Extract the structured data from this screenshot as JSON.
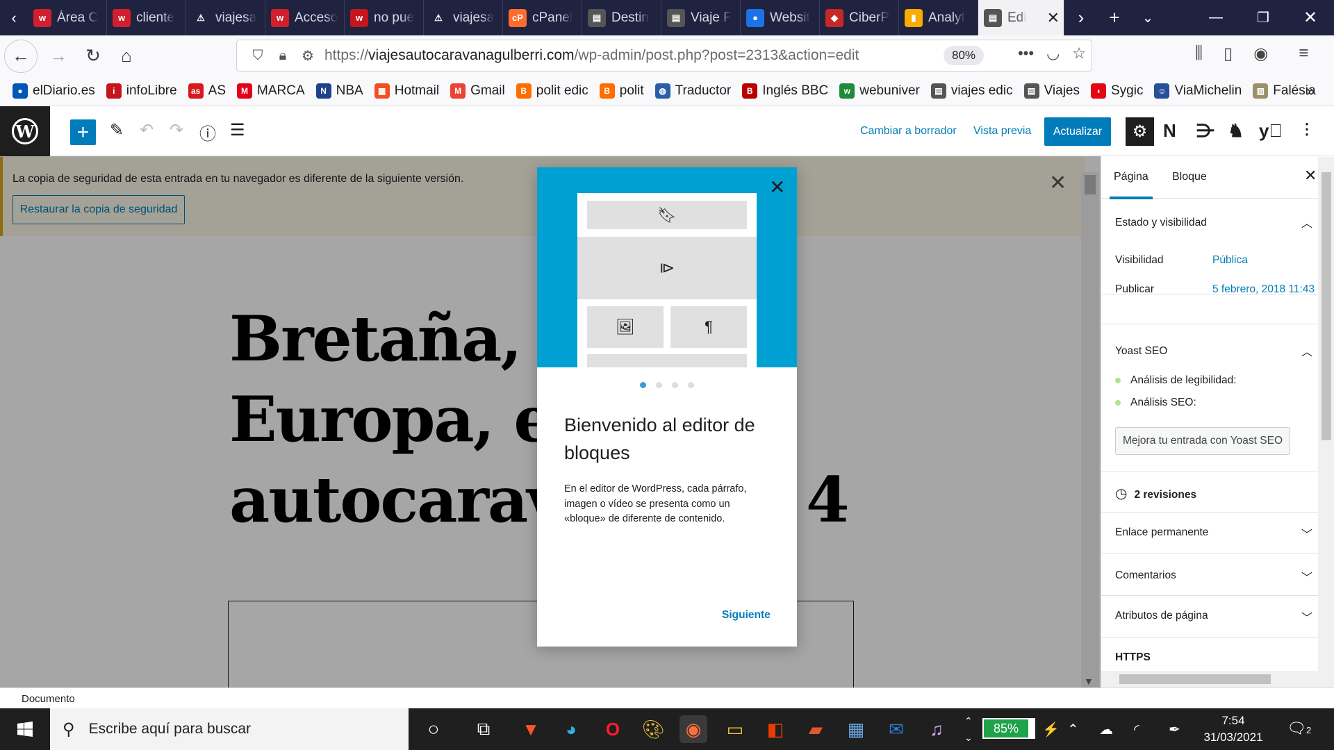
{
  "browser": {
    "tabs": [
      {
        "label": "Área C",
        "fav": "w",
        "color": "#d11f2d"
      },
      {
        "label": "cliente",
        "fav": "w",
        "color": "#d11f2d"
      },
      {
        "label": "viajesa",
        "fav": "⚠",
        "color": "#202340"
      },
      {
        "label": "Acceso",
        "fav": "w",
        "color": "#d11f2d"
      },
      {
        "label": "no pue",
        "fav": "w",
        "color": "#c4161c"
      },
      {
        "label": "viajesa",
        "fav": "⚠",
        "color": "#202340"
      },
      {
        "label": "cPanel",
        "fav": "cP",
        "color": "#ff6c2c"
      },
      {
        "label": "Destin",
        "fav": "▤",
        "color": "#555"
      },
      {
        "label": "Viaje F",
        "fav": "▤",
        "color": "#555"
      },
      {
        "label": "Websit",
        "fav": "●",
        "color": "#1a73e8"
      },
      {
        "label": "CiberP",
        "fav": "◆",
        "color": "#c62828"
      },
      {
        "label": "Analyt",
        "fav": "▮",
        "color": "#f9ab00"
      }
    ],
    "active_tab": {
      "label": "Edi"
    },
    "url_prefix": "https://",
    "url_domain": "viajesautocaravanagulberri.com",
    "url_path": "/wp-admin/post.php?post=2313&action=edit",
    "zoom": "80%",
    "bookmarks": [
      {
        "label": "elDiario.es",
        "fav": "●",
        "color": "#0057b8"
      },
      {
        "label": "infoLibre",
        "fav": "i",
        "color": "#c4161c"
      },
      {
        "label": "AS",
        "fav": "as",
        "color": "#d71920"
      },
      {
        "label": "MARCA",
        "fav": "M",
        "color": "#e2001a"
      },
      {
        "label": "NBA",
        "fav": "N",
        "color": "#1d428a"
      },
      {
        "label": "Hotmail",
        "fav": "▦",
        "color": "#f25022"
      },
      {
        "label": "Gmail",
        "fav": "M",
        "color": "#ea4335"
      },
      {
        "label": "polit edic",
        "fav": "B",
        "color": "#ff6d00"
      },
      {
        "label": "polit",
        "fav": "B",
        "color": "#ff6d00"
      },
      {
        "label": "Traductor",
        "fav": "◍",
        "color": "#2a5ea7"
      },
      {
        "label": "Inglés BBC",
        "fav": "B",
        "color": "#b80000"
      },
      {
        "label": "webuniver",
        "fav": "w",
        "color": "#1e8a3c"
      },
      {
        "label": "viajes edic",
        "fav": "▤",
        "color": "#555"
      },
      {
        "label": "Viajes",
        "fav": "▤",
        "color": "#555"
      },
      {
        "label": "Sygic",
        "fav": "◖",
        "color": "#e30613"
      },
      {
        "label": "ViaMichelin",
        "fav": "☺",
        "color": "#27509b"
      },
      {
        "label": "Falésia",
        "fav": "▥",
        "color": "#9c8f6a"
      }
    ]
  },
  "editor": {
    "header": {
      "switch_draft": "Cambiar a borrador",
      "preview": "Vista previa",
      "update": "Actualizar"
    },
    "notice": {
      "text": "La copia de seguridad de esta entrada en tu navegador es diferente de la siguiente versión.",
      "button": "Restaurar la copia de seguridad"
    },
    "post_title_lines": [
      "Bretaña, Fr",
      "Europa, en",
      "autocarava"
    ],
    "title_tail": "4",
    "footer": "Documento"
  },
  "sidebar": {
    "tabs": [
      "Página",
      "Bloque"
    ],
    "status_title": "Estado y visibilidad",
    "visibility_label": "Visibilidad",
    "visibility_value": "Pública",
    "publish_label": "Publicar",
    "publish_value": "5 febrero, 2018 11:43",
    "yoast_title": "Yoast SEO",
    "yoast_readability": "Análisis de legibilidad:",
    "yoast_seo": "Análisis SEO:",
    "yoast_button": "Mejora tu entrada con Yoast SEO",
    "revisions": "2 revisiones",
    "permalink": "Enlace permanente",
    "comments": "Comentarios",
    "page_attributes": "Atributos de página",
    "https": "HTTPS"
  },
  "modal": {
    "title": "Bienvenido al editor de bloques",
    "body": "En el editor de WordPress, cada párrafo, imagen o vídeo se presenta como un «bloque» de diferente de contenido.",
    "next": "Siguiente",
    "page_index": 1,
    "page_count": 4,
    "hero_color": "#00a0d2"
  },
  "taskbar": {
    "search_placeholder": "Escribe aquí para buscar",
    "battery": "85%",
    "time": "7:54",
    "date": "31/03/2021",
    "notifications": "2"
  }
}
